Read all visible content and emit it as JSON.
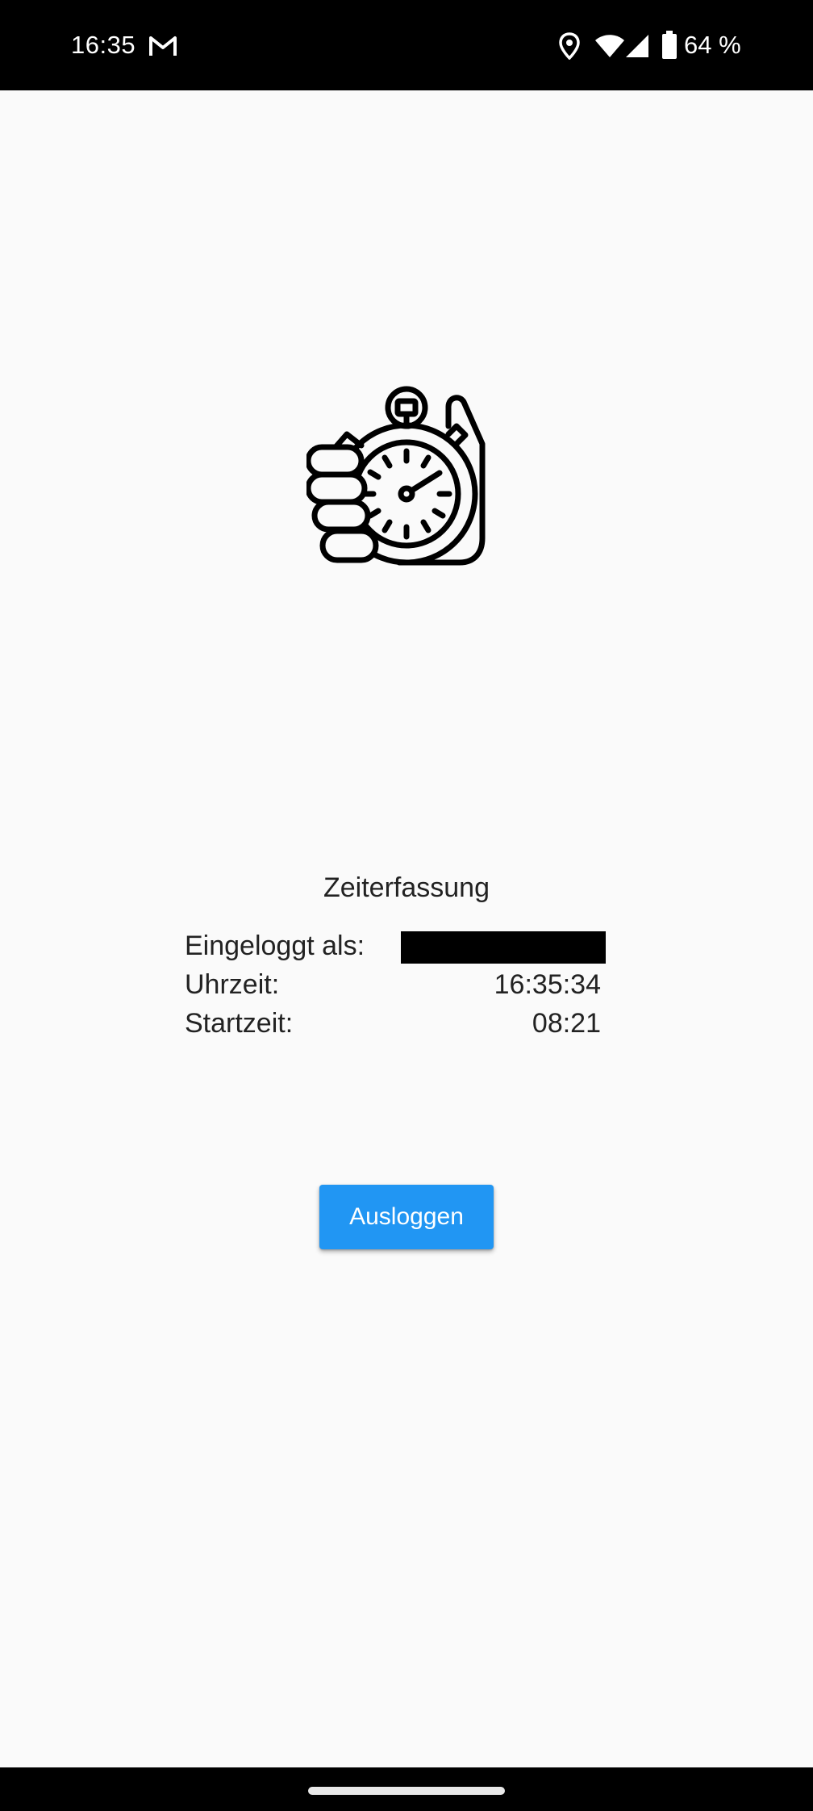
{
  "status_bar": {
    "time": "16:35",
    "battery_text": "64 %",
    "icons": [
      "gmail-icon",
      "location-icon",
      "wifi-icon",
      "signal-icon",
      "battery-icon"
    ]
  },
  "app": {
    "logo_icon": "stopwatch-in-hand-icon",
    "title": "Zeiterfassung",
    "rows": [
      {
        "label": "Eingeloggt als:",
        "value": ""
      },
      {
        "label": "Uhrzeit:",
        "value": "16:35:34"
      },
      {
        "label": "Startzeit:",
        "value": "08:21"
      }
    ],
    "logout_label": "Ausloggen"
  },
  "colors": {
    "background": "#fafafa",
    "accent": "#2196f3",
    "status_bar": "#000000"
  }
}
